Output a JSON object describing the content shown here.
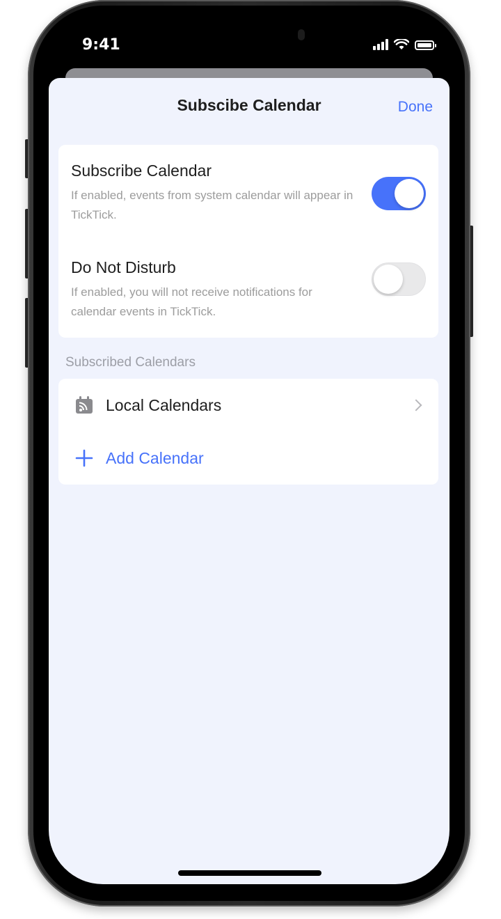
{
  "status_bar": {
    "time": "9:41"
  },
  "nav": {
    "title": "Subscibe Calendar",
    "done_label": "Done"
  },
  "settings": [
    {
      "title": "Subscribe Calendar",
      "description": "If enabled, events from system calendar will appear in TickTick.",
      "enabled": true
    },
    {
      "title": "Do Not Disturb",
      "description": "If enabled, you will not receive notifications for calendar events in TickTick.",
      "enabled": false
    }
  ],
  "subscribed": {
    "header": "Subscribed Calendars",
    "items": [
      {
        "label": "Local Calendars",
        "icon": "calendar-feed-icon"
      }
    ],
    "add_label": "Add Calendar"
  },
  "colors": {
    "accent": "#4772fa",
    "background": "#f0f3fd",
    "card": "#ffffff",
    "text_primary": "#1e1e1e",
    "text_secondary": "#9c9c9c"
  }
}
